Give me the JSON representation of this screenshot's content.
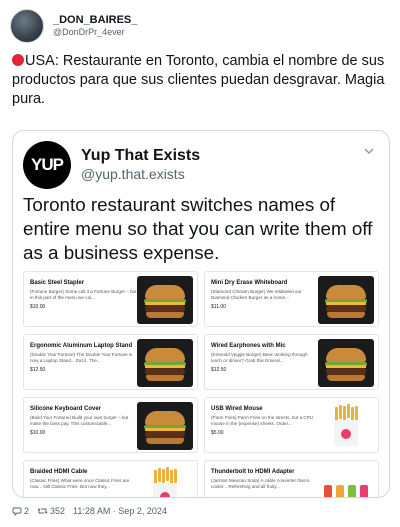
{
  "author": {
    "display_name": "_DON_BAIRES_",
    "handle": "@DonDrPr_4ever"
  },
  "tweet": {
    "emoji": "red-circle-icon",
    "text": "USA: Restaurante en Toronto, cambia el nombre de sus productos para que sus clientes puedan desgravar. Magia pura."
  },
  "quoted": {
    "logo_text": "YUP",
    "name": "Yup That Exists",
    "handle": "@yup.that.exists",
    "text": "Toronto restaurant switches names of entire menu so that you can write them off as a business expense.",
    "menu": [
      {
        "name": "Basic Steel Stapler",
        "desc": "(Fortune Burger) Some call it a Fortune Burger – but in this part of the menu we cal...",
        "price": "$10.00",
        "image": "burger"
      },
      {
        "name": "Mini Dry Erase Whiteboard",
        "desc": "(Diamond Chicken Burger) We relabeled our Diamond Chicken Burger as a home...",
        "price": "$11.00",
        "image": "burger"
      },
      {
        "name": "Ergonomic Aluminum Laptop Stand",
        "desc": "(Double Your Fortune) The Double Your Fortune is now a Laptop Stand... Eat it. The...",
        "price": "$12.50",
        "image": "burger"
      },
      {
        "name": "Wired Earphones with Mic",
        "desc": "(Emerald Veggie Burger) Been working through lunch or dinner? Grab this Emeral...",
        "price": "$12.50",
        "image": "burger"
      },
      {
        "name": "Silicone Keyboard Cover",
        "desc": "(Build Your Fortune) Build your own burger – but make the boss pay. This customizable...",
        "price": "$10.00",
        "image": "burger"
      },
      {
        "name": "USB Wired Mouse",
        "desc": "(Parm Fries) Parm Fries on the streets, but a CPU mouse in the (expense) sheets. Order...",
        "price": "$5.00",
        "image": "fries"
      },
      {
        "name": "Braided HDMI Cable",
        "desc": "(Classic Fries) What were once Classic Fries are now... still Classic Fries. But now they...",
        "price": "",
        "image": "fries"
      },
      {
        "name": "Thunderbolt to HDMI Adapter",
        "desc": "(Jarritos Mexican Soda) A cable converter that is cooler... Refreshing and all fruity...",
        "price": "",
        "image": "soda"
      }
    ]
  },
  "meta": {
    "replies": "2",
    "retweets": "352",
    "timestamp": "11:28 AM · Sep 2, 2024"
  }
}
